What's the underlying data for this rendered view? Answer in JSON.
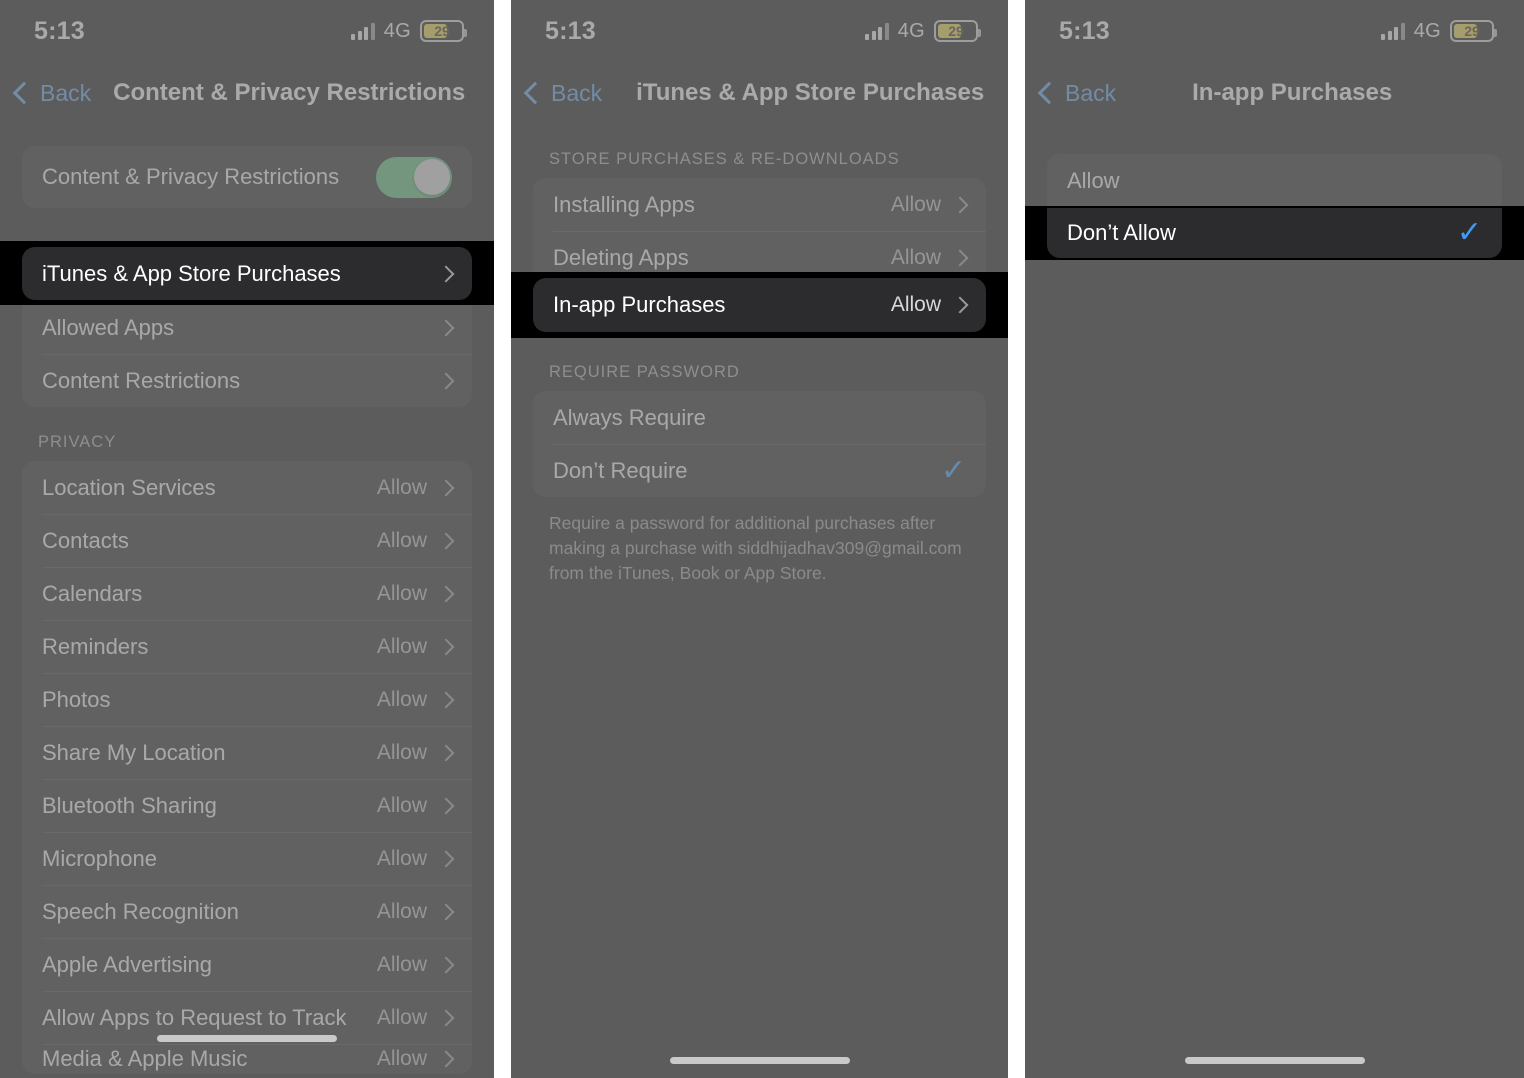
{
  "status": {
    "time": "5:13",
    "network": "4G",
    "battery_percent": "29",
    "signal_icon": "cellular-bars-icon",
    "battery_icon": "battery-low-power-icon"
  },
  "colors": {
    "accent_blue": "#3b9bf5",
    "back_blue": "#5aa1e8",
    "toggle_green": "#5fbd7e",
    "battery_yellow": "#e6d34a",
    "card_bg": "#2c2c2e",
    "screen_bg": "#1c1c1e",
    "veil": "rgba(128,128,128,0.64)"
  },
  "panels": [
    {
      "back_label": "Back",
      "title": "Content & Privacy Restrictions",
      "master_toggle": {
        "label": "Content & Privacy Restrictions",
        "state": "on"
      },
      "menu": [
        {
          "label": "iTunes & App Store Purchases",
          "value": "",
          "highlighted": true
        },
        {
          "label": "Allowed Apps",
          "value": "",
          "highlighted": false
        },
        {
          "label": "Content Restrictions",
          "value": "",
          "highlighted": false
        }
      ],
      "privacy_header": "PRIVACY",
      "privacy": [
        {
          "label": "Location Services",
          "value": "Allow"
        },
        {
          "label": "Contacts",
          "value": "Allow"
        },
        {
          "label": "Calendars",
          "value": "Allow"
        },
        {
          "label": "Reminders",
          "value": "Allow"
        },
        {
          "label": "Photos",
          "value": "Allow"
        },
        {
          "label": "Share My Location",
          "value": "Allow"
        },
        {
          "label": "Bluetooth Sharing",
          "value": "Allow"
        },
        {
          "label": "Microphone",
          "value": "Allow"
        },
        {
          "label": "Speech Recognition",
          "value": "Allow"
        },
        {
          "label": "Apple Advertising",
          "value": "Allow"
        },
        {
          "label": "Allow Apps to Request to Track",
          "value": "Allow"
        },
        {
          "label": "Media & Apple Music",
          "value": "Allow"
        }
      ]
    },
    {
      "back_label": "Back",
      "title": "iTunes & App Store Purchases",
      "store_header": "STORE PURCHASES & RE-DOWNLOADS",
      "store": [
        {
          "label": "Installing Apps",
          "value": "Allow",
          "highlighted": false
        },
        {
          "label": "Deleting Apps",
          "value": "Allow",
          "highlighted": false
        },
        {
          "label": "In-app Purchases",
          "value": "Allow",
          "highlighted": true
        }
      ],
      "password_header": "REQUIRE PASSWORD",
      "password": [
        {
          "label": "Always Require",
          "checked": false
        },
        {
          "label": "Don’t Require",
          "checked": true
        }
      ],
      "footnote": "Require a password for additional purchases after making a purchase with siddhijadhav309@gmail.com from the iTunes, Book or App Store."
    },
    {
      "back_label": "Back",
      "title": "In-app Purchases",
      "options": [
        {
          "label": "Allow",
          "checked": false,
          "highlighted": false
        },
        {
          "label": "Don’t Allow",
          "checked": true,
          "highlighted": true
        }
      ]
    }
  ]
}
